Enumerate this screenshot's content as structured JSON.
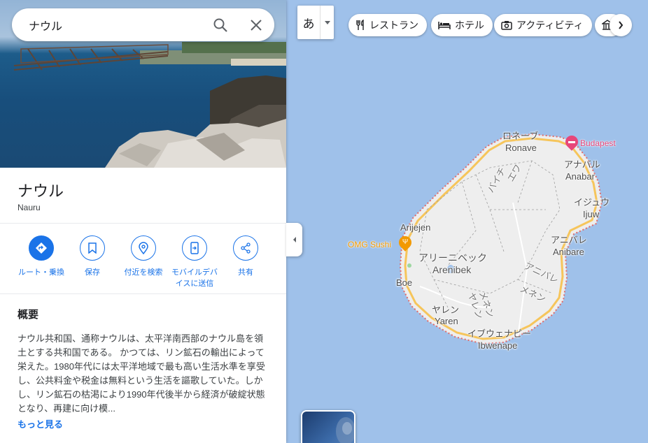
{
  "search": {
    "value": "ナウル",
    "search_icon": "search-icon",
    "close_icon": "close-icon"
  },
  "place": {
    "title": "ナウル",
    "subtitle": "Nauru"
  },
  "actions": [
    {
      "label": "ルート・乗換",
      "icon": "directions-icon"
    },
    {
      "label": "保存",
      "icon": "bookmark-icon"
    },
    {
      "label": "付近を検索",
      "icon": "nearby-icon"
    },
    {
      "label": "モバイルデバイスに送信",
      "icon": "send-to-phone-icon"
    },
    {
      "label": "共有",
      "icon": "share-icon"
    }
  ],
  "overview": {
    "title": "概要",
    "body": "ナウル共和国、通称ナウルは、太平洋南西部のナウル島を領土とする共和国である。 かつては、リン鉱石の輸出によって栄えた。1980年代には太平洋地域で最も高い生活水準を享受し、公共料金や税金は無料という生活を謳歌していた。しかし、リン鉱石の枯渇により1990年代後半から経済が破綻状態となり、再建に向け模...",
    "more": "もっと見る"
  },
  "map_controls": {
    "lang_glyph": "あ",
    "chips": [
      {
        "label": "レストラン",
        "icon": "restaurant-icon"
      },
      {
        "label": "ホテル",
        "icon": "hotel-icon"
      },
      {
        "label": "アクティビティ",
        "icon": "camera-icon"
      }
    ]
  },
  "map_labels": {
    "ronave_jp": "ロネーブ",
    "ronave_en": "Ronave",
    "anabar_jp": "アナバル",
    "anabar_en": "Anabar",
    "ijuw_jp": "イジュウ",
    "ijuw_en": "Ijuw",
    "anibare_jp": "アニバレ",
    "anibare_en": "Anibare",
    "arijejen_en": "Arijejen",
    "arenibek_jp": "アリーニベック",
    "arenibek_en": "Arenibek",
    "boe_en": "Boe",
    "yaren_jp": "ヤレン",
    "yaren_en": "Yaren",
    "ibwenape_jp": "イブウェナピー",
    "ibwenape_en": "Ibwenape",
    "ewa_jp": "エワ",
    "baiti_jp": "バイチ",
    "meneng_jp": "メネン",
    "meneng2_jp": "メネン",
    "anibare_vert": "アニバレ",
    "yaren_vert": "ヤレン"
  },
  "pois": {
    "restaurant": "OMG Sushi",
    "hotel": "Budapest",
    "restaurant_color": "#f29900",
    "hotel_color": "#e7477a"
  },
  "colors": {
    "accent": "#1a73e8",
    "water": "#9fc1ea",
    "land": "#eeeeee",
    "coast_road": "#f6c55b"
  }
}
